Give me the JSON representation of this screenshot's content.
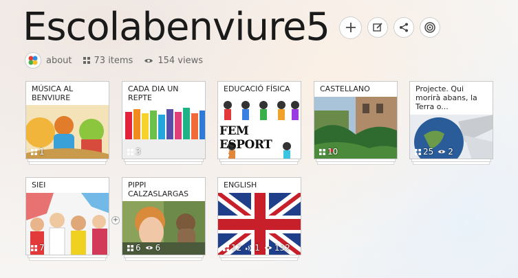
{
  "page": {
    "title": "Escolabenviure5"
  },
  "meta": {
    "about": "about",
    "items": "73 items",
    "views": "154 views"
  },
  "cards": [
    {
      "label": "MÚSICA AL BENVIURE",
      "stats": [
        "1"
      ]
    },
    {
      "label": "CADA DIA UN REPTE",
      "stats": [
        "3"
      ]
    },
    {
      "label": "EDUCACIÓ FÍSICA",
      "stats": [
        "",
        "FEM ESPORT"
      ]
    },
    {
      "label": "CASTELLANO",
      "stats": [
        "10"
      ]
    },
    {
      "label": "Projecte. Qui morirà abans, la Terra o...",
      "stats": [
        "25",
        "2"
      ]
    },
    {
      "label": "SIEI",
      "stats": [
        "7"
      ]
    },
    {
      "label": "PIPPI CALZASLARGAS",
      "stats": [
        "6",
        "6"
      ]
    },
    {
      "label": "ENGLISH",
      "stats": [
        "12",
        "1",
        "132"
      ]
    }
  ],
  "colors": {
    "card_border": "#c8c8c8",
    "text_muted": "#666666"
  }
}
